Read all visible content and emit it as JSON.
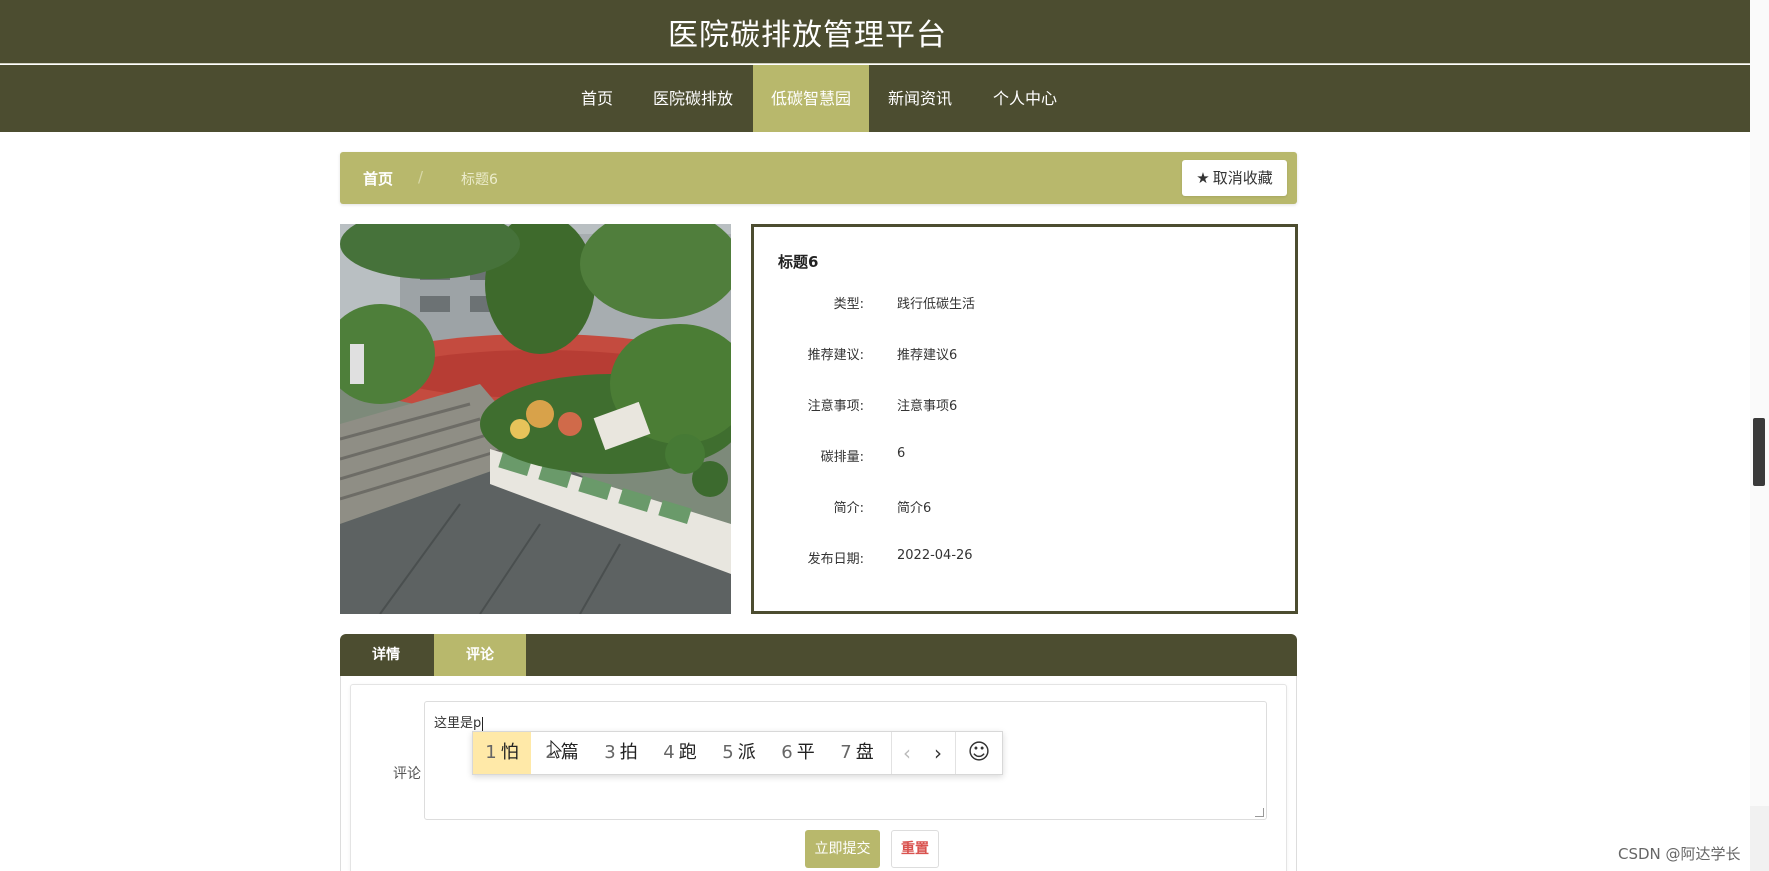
{
  "site": {
    "title": "医院碳排放管理平台"
  },
  "nav": {
    "items": [
      {
        "label": "首页"
      },
      {
        "label": "医院碳排放"
      },
      {
        "label": "低碳智慧园"
      },
      {
        "label": "新闻资讯"
      },
      {
        "label": "个人中心"
      }
    ],
    "active": "低碳智慧园"
  },
  "breadcrumb": {
    "home": "首页",
    "separator": "/",
    "current": "标题6"
  },
  "favorite": {
    "label": "取消收藏",
    "icon": "star-icon"
  },
  "detail": {
    "title": "标题6",
    "fields": [
      {
        "label": "类型:",
        "value": "践行低碳生活"
      },
      {
        "label": "推荐建议:",
        "value": "推荐建议6"
      },
      {
        "label": "注意事项:",
        "value": "注意事项6"
      },
      {
        "label": "碳排量:",
        "value": "6"
      },
      {
        "label": "简介:",
        "value": "简介6"
      },
      {
        "label": "发布日期:",
        "value": "2022-04-26"
      }
    ]
  },
  "tabs": [
    {
      "label": "详情"
    },
    {
      "label": "评论"
    }
  ],
  "active_tab": "评论",
  "comment": {
    "label": "评论",
    "value": "这里是p"
  },
  "ime": {
    "candidates": [
      {
        "num": "1",
        "char": "怕"
      },
      {
        "num": "2",
        "char": "篇"
      },
      {
        "num": "3",
        "char": "拍"
      },
      {
        "num": "4",
        "char": "跑"
      },
      {
        "num": "5",
        "char": "派"
      },
      {
        "num": "6",
        "char": "平"
      },
      {
        "num": "7",
        "char": "盘"
      }
    ],
    "prev": "‹",
    "next": "›",
    "emoji": "☺"
  },
  "buttons": {
    "submit": "立即提交",
    "reset": "重置"
  },
  "watermark": "CSDN @阿达学长",
  "colors": {
    "header": "#4c4d30",
    "accent": "#b8b86c",
    "reset_text": "#d9534f"
  }
}
